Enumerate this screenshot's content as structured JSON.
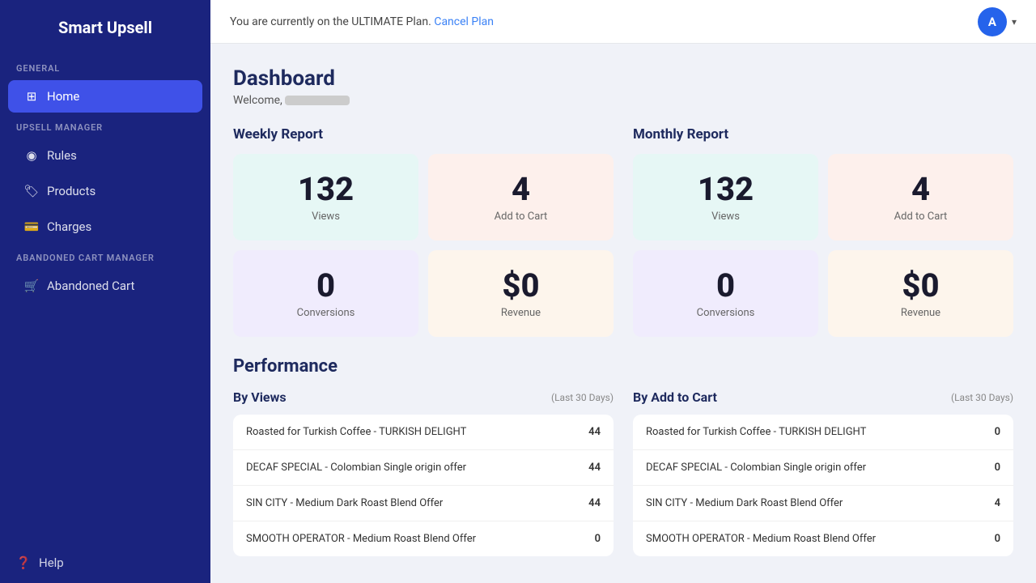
{
  "app": {
    "title": "Smart Upsell"
  },
  "topbar": {
    "plan_message": "You are currently on the ULTIMATE Plan.",
    "cancel_link": "Cancel Plan",
    "avatar_initial": "A"
  },
  "sidebar": {
    "general_label": "GENERAL",
    "home_label": "Home",
    "upsell_label": "UPSELL MANAGER",
    "rules_label": "Rules",
    "products_label": "Products",
    "charges_label": "Charges",
    "abandoned_label": "ABANDONED CART MANAGER",
    "abandoned_cart_label": "Abandoned Cart",
    "help_label": "Help"
  },
  "dashboard": {
    "title": "Dashboard",
    "welcome": "Welcome,"
  },
  "weekly": {
    "title": "Weekly Report",
    "views": "132",
    "views_label": "Views",
    "add_to_cart": "4",
    "add_to_cart_label": "Add to Cart",
    "conversions": "0",
    "conversions_label": "Conversions",
    "revenue": "$0",
    "revenue_label": "Revenue"
  },
  "monthly": {
    "title": "Monthly Report",
    "views": "132",
    "views_label": "Views",
    "add_to_cart": "4",
    "add_to_cart_label": "Add to Cart",
    "conversions": "0",
    "conversions_label": "Conversions",
    "revenue": "$0",
    "revenue_label": "Revenue"
  },
  "performance": {
    "title": "Performance",
    "by_views": {
      "title": "By Views",
      "period": "(Last 30 Days)",
      "rows": [
        {
          "name": "Roasted for Turkish Coffee - TURKISH DELIGHT",
          "value": "44"
        },
        {
          "name": "DECAF SPECIAL - Colombian Single origin offer",
          "value": "44"
        },
        {
          "name": "SIN CITY - Medium Dark Roast Blend Offer",
          "value": "44"
        },
        {
          "name": "SMOOTH OPERATOR - Medium Roast Blend Offer",
          "value": "0"
        }
      ]
    },
    "by_add_to_cart": {
      "title": "By Add to Cart",
      "period": "(Last 30 Days)",
      "rows": [
        {
          "name": "Roasted for Turkish Coffee - TURKISH DELIGHT",
          "value": "0"
        },
        {
          "name": "DECAF SPECIAL - Colombian Single origin offer",
          "value": "0"
        },
        {
          "name": "SIN CITY - Medium Dark Roast Blend Offer",
          "value": "4"
        },
        {
          "name": "SMOOTH OPERATOR - Medium Roast Blend Offer",
          "value": "0"
        }
      ]
    }
  }
}
